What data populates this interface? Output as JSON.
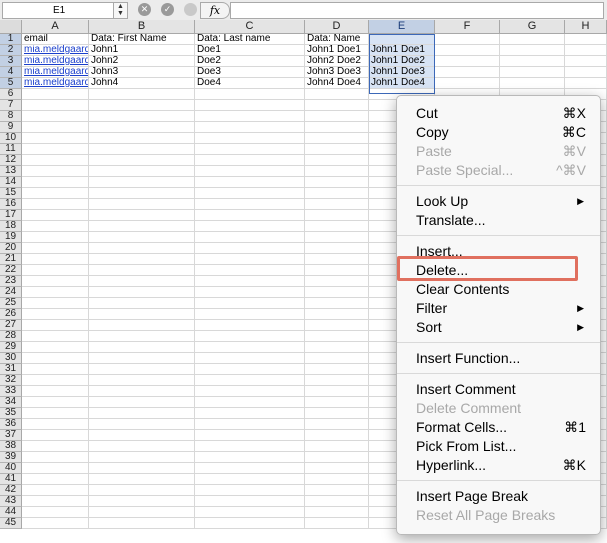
{
  "formula_bar": {
    "cell_ref": "E1",
    "fx_label": "fx",
    "formula": ""
  },
  "columns": [
    {
      "label": "A",
      "width": 67
    },
    {
      "label": "B",
      "width": 106
    },
    {
      "label": "C",
      "width": 110
    },
    {
      "label": "D",
      "width": 64
    },
    {
      "label": "E",
      "width": 66,
      "selected": true
    },
    {
      "label": "F",
      "width": 65
    },
    {
      "label": "G",
      "width": 65
    },
    {
      "label": "H",
      "width": 42
    }
  ],
  "rows": [
    "1",
    "2",
    "3",
    "4",
    "5",
    "6",
    "7",
    "8",
    "9",
    "10",
    "11",
    "12",
    "13",
    "14",
    "15",
    "16",
    "17",
    "18",
    "19",
    "20",
    "21",
    "22",
    "23",
    "24",
    "25",
    "26",
    "27",
    "28",
    "29",
    "30",
    "31",
    "32",
    "33",
    "34",
    "35",
    "36",
    "37",
    "38",
    "39",
    "40",
    "41",
    "42",
    "43",
    "44",
    "45"
  ],
  "cells": [
    [
      "email",
      "Data: First Name",
      "Data: Last name",
      "Data: Name",
      "",
      "",
      "",
      ""
    ],
    [
      "mia.meldgaard",
      "John1",
      "Doe1",
      "John1  Doe1",
      "John1  Doe1",
      "",
      "",
      ""
    ],
    [
      "mia.meldgaard",
      "John2",
      "Doe2",
      "John2 Doe2",
      "John1  Doe2",
      "",
      "",
      ""
    ],
    [
      "mia.meldgaard",
      "John3",
      "Doe3",
      "John3 Doe3",
      "John1  Doe3",
      "",
      "",
      ""
    ],
    [
      "mia.meldgaard",
      "John4",
      "Doe4",
      "John4 Doe4",
      "John1  Doe4",
      "",
      "",
      ""
    ]
  ],
  "context_menu": {
    "items": [
      {
        "label": "Cut",
        "shortcut": "⌘X"
      },
      {
        "label": "Copy",
        "shortcut": "⌘C"
      },
      {
        "label": "Paste",
        "shortcut": "⌘V",
        "disabled": true
      },
      {
        "label": "Paste Special...",
        "shortcut": "^⌘V",
        "disabled": true
      },
      {
        "separator": true
      },
      {
        "label": "Look Up",
        "submenu": true
      },
      {
        "label": "Translate..."
      },
      {
        "separator": true
      },
      {
        "label": "Insert..."
      },
      {
        "label": "Delete...",
        "highlighted": true
      },
      {
        "label": "Clear Contents"
      },
      {
        "label": "Filter",
        "submenu": true
      },
      {
        "label": "Sort",
        "submenu": true
      },
      {
        "separator": true
      },
      {
        "label": "Insert Function..."
      },
      {
        "separator": true
      },
      {
        "label": "Insert Comment"
      },
      {
        "label": "Delete Comment",
        "disabled": true
      },
      {
        "label": "Format Cells...",
        "shortcut": "⌘1"
      },
      {
        "label": "Pick From List..."
      },
      {
        "label": "Hyperlink...",
        "shortcut": "⌘K"
      },
      {
        "separator": true
      },
      {
        "label": "Insert Page Break"
      },
      {
        "label": "Reset All Page Breaks",
        "disabled": true
      }
    ]
  },
  "colors": {
    "selection": "#3c68b8",
    "highlight_box": "#e0705f",
    "link": "#1a3fcc"
  }
}
